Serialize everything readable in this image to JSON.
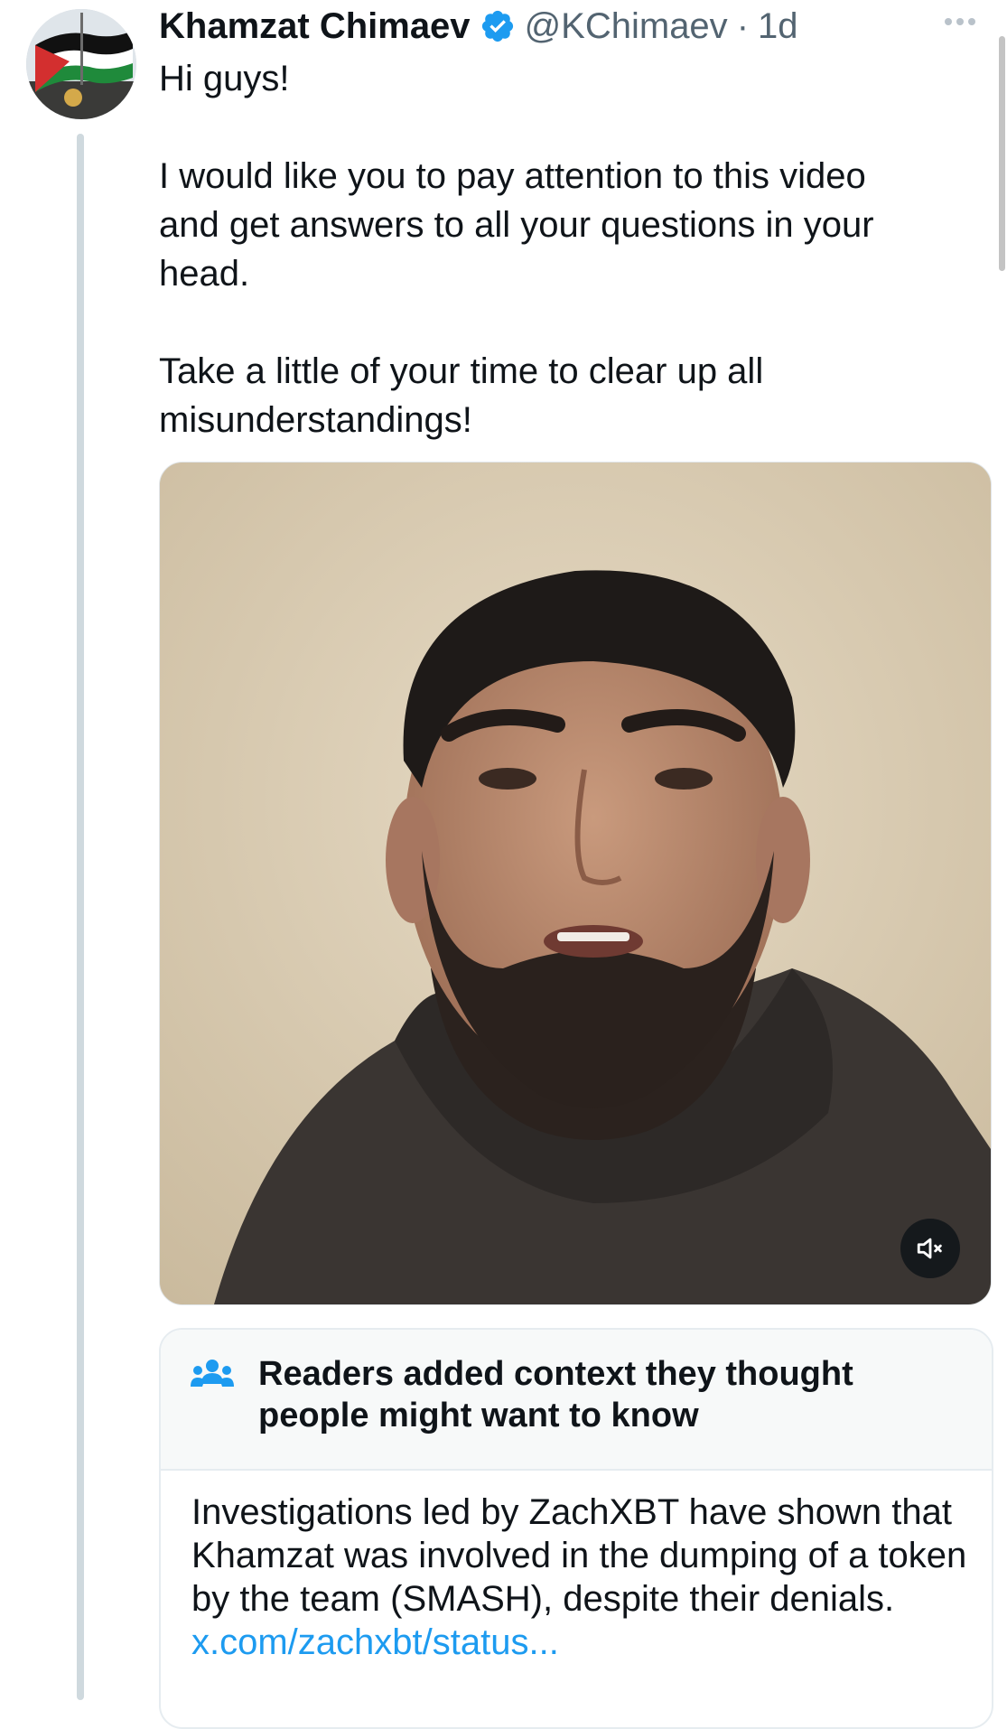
{
  "author": {
    "name": "Khamzat Chimaev",
    "handle": "@KChimaev",
    "separator": "·",
    "time": "1d",
    "verified": true
  },
  "tweet": {
    "text": "Hi guys!\n\nI would like you to pay attention to this video\nand get answers to all your questions in your\nhead.\n\nTake a little of your time to clear up all\nmisunderstandings!"
  },
  "media": {
    "type": "video",
    "muted": true,
    "mute_icon": "speaker-muted-icon"
  },
  "community_note": {
    "icon": "people-icon",
    "title": "Readers added context they thought people might want to know",
    "body": "Investigations led by ZachXBT have shown that Khamzat was involved in the dumping of a token by the team (SMASH), despite their denials.",
    "link": "x.com/zachxbt/status..."
  },
  "colors": {
    "verified": "#1d9bf0",
    "link": "#1d9bf0",
    "secondary_text": "#536471",
    "thread_line": "#cfd9de"
  }
}
